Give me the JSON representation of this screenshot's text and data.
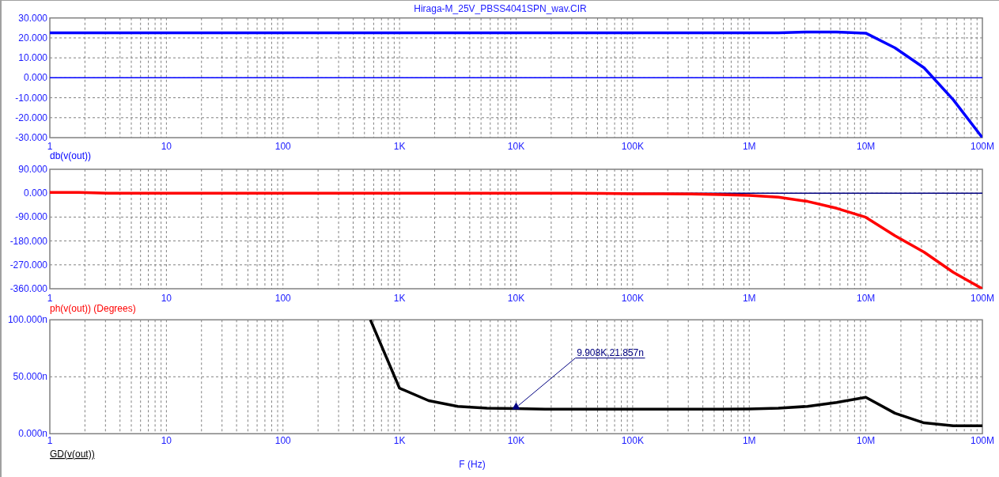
{
  "window": {
    "title": "Hiraga-M_25V_PBSS4041SPN_wav.CIR"
  },
  "plots": [
    {
      "selected": false,
      "chart_data": {
        "type": "line",
        "categories": [
          "1",
          null,
          null,
          null,
          "10",
          null,
          null,
          null,
          "100",
          null,
          null,
          null,
          "1K",
          null,
          null,
          null,
          "10K",
          null,
          null,
          null,
          "100K",
          null,
          null,
          null,
          "1M",
          null,
          null,
          null,
          "10M",
          null,
          null,
          null,
          "100M"
        ],
        "ylim": [
          -30,
          30
        ],
        "yticks": [
          {
            "value": 30,
            "label": "30.000"
          },
          {
            "value": 20,
            "label": "20.000"
          },
          {
            "value": 10,
            "label": "10.000"
          },
          {
            "value": 0,
            "label": "0.000"
          },
          {
            "value": -10,
            "label": "-10.000"
          },
          {
            "value": -20,
            "label": "-20.000"
          },
          {
            "value": -30,
            "label": "-30.000"
          }
        ],
        "series": [
          {
            "name": "db(v(out))",
            "color": "#0000ff",
            "values": [
              22.6,
              22.6,
              22.6,
              22.6,
              22.6,
              22.6,
              22.6,
              22.6,
              22.6,
              22.6,
              22.6,
              22.6,
              22.6,
              22.6,
              22.6,
              22.6,
              22.6,
              22.6,
              22.6,
              22.6,
              22.6,
              22.6,
              22.6,
              22.6,
              22.6,
              22.6,
              23.0,
              23.0,
              22.4,
              15,
              5,
              -11,
              -30
            ]
          }
        ],
        "grid": true,
        "ref_lines": [
          {
            "axis": "y",
            "value": 0,
            "color": "#0000ff"
          }
        ]
      }
    },
    {
      "selected": false,
      "chart_data": {
        "type": "line",
        "categories": [
          "1",
          null,
          null,
          null,
          "10",
          null,
          null,
          null,
          "100",
          null,
          null,
          null,
          "1K",
          null,
          null,
          null,
          "10K",
          null,
          null,
          null,
          "100K",
          null,
          null,
          null,
          "1M",
          null,
          null,
          null,
          "10M",
          null,
          null,
          null,
          "100M"
        ],
        "ylim": [
          -360,
          90
        ],
        "yticks": [
          {
            "value": 90,
            "label": "90.000"
          },
          {
            "value": 0,
            "label": "0.000"
          },
          {
            "value": -90,
            "label": "-90.000"
          },
          {
            "value": -180,
            "label": "-180.000"
          },
          {
            "value": -270,
            "label": "-270.000"
          },
          {
            "value": -360,
            "label": "-360.000"
          }
        ],
        "series": [
          {
            "name": "ph(v(out)) (Degrees)",
            "color": "#ff0000",
            "values": [
              3,
              3,
              0,
              0,
              0,
              0,
              0,
              0,
              0,
              0,
              0,
              0,
              0,
              0,
              0,
              0,
              0,
              0,
              0,
              -1,
              -2,
              -2,
              -3,
              -5,
              -8,
              -15,
              -31,
              -57,
              -91,
              -160,
              -222,
              -298,
              -360
            ]
          }
        ],
        "grid": true,
        "ref_lines": [
          {
            "axis": "y",
            "value": 0,
            "color": "#000080"
          }
        ]
      }
    },
    {
      "selected": true,
      "chart_data": {
        "type": "line",
        "xlabel": "F (Hz)",
        "categories": [
          "1",
          null,
          null,
          null,
          "10",
          null,
          null,
          null,
          "100",
          null,
          null,
          null,
          "1K",
          null,
          null,
          null,
          "10K",
          null,
          null,
          null,
          "100K",
          null,
          null,
          null,
          "1M",
          null,
          null,
          null,
          "10M",
          null,
          null,
          null,
          "100M"
        ],
        "ylim": [
          0,
          100
        ],
        "yticks": [
          {
            "value": 100,
            "label": "100.000n"
          },
          {
            "value": 50,
            "label": "50.000n"
          },
          {
            "value": 0,
            "label": "0.000n"
          }
        ],
        "series": [
          {
            "name": "GD(v(out))",
            "color": "#000000",
            "values": [
              null,
              null,
              null,
              null,
              null,
              null,
              null,
              null,
              null,
              null,
              null,
              100,
              40,
              29,
              24,
              22.5,
              22,
              21.6,
              21.6,
              21.6,
              21.6,
              21.6,
              21.6,
              21.6,
              21.8,
              22.5,
              24,
              27.5,
              32,
              18,
              9.5,
              7,
              7
            ]
          }
        ],
        "grid": true,
        "annotations": [
          {
            "x": "10K",
            "y": 22,
            "text": "9.908K,21.857n"
          }
        ]
      }
    }
  ]
}
